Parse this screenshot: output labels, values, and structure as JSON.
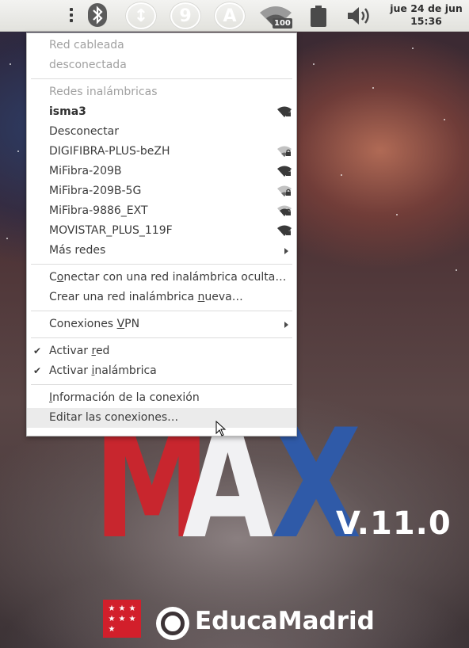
{
  "top_panel": {
    "circle_icons": [
      "↕",
      "9",
      "A"
    ],
    "wifi_badge": "100",
    "clock_date": "jue 24 de jun",
    "clock_time": "15:36"
  },
  "menu": {
    "wired_header": "Red cableada",
    "wired_status": "desconectada",
    "wireless_header": "Redes inalámbricas",
    "connected_network": "isma3",
    "disconnect": "Desconectar",
    "networks": [
      {
        "name": "DIGIFIBRA-PLUS-beZH",
        "signal": "low"
      },
      {
        "name": "MiFibra-209B",
        "signal": "high"
      },
      {
        "name": "MiFibra-209B-5G",
        "signal": "low"
      },
      {
        "name": "MiFibra-9886_EXT",
        "signal": "medium"
      },
      {
        "name": "MOVISTAR_PLUS_119F",
        "signal": "high"
      }
    ],
    "more_networks": "Más redes",
    "connect_hidden_pre": "C",
    "connect_hidden_u": "o",
    "connect_hidden_post": "nectar con una red inalámbrica oculta…",
    "create_new_pre": "Crear una red inalámbrica ",
    "create_new_u": "n",
    "create_new_post": "ueva…",
    "vpn_pre": "Conexiones ",
    "vpn_u": "V",
    "vpn_post": "PN",
    "enable_network_pre": "Activar ",
    "enable_network_u": "r",
    "enable_network_post": "ed",
    "enable_wireless_pre": "Activar ",
    "enable_wireless_u": "i",
    "enable_wireless_post": "nalámbrica",
    "connection_info_pre": "",
    "connection_info_u": "I",
    "connection_info_post": "nformación de la conexión",
    "edit_connections": "Editar las conexiones…"
  },
  "wallpaper": {
    "logo_letters": [
      "M",
      "A",
      "X"
    ],
    "version": "V.11.0",
    "brand": "EducaMadrid",
    "colors": {
      "m": "#c8262e",
      "a": "#f1f1f3",
      "x": "#2f5aa8",
      "flag": "#d21f2b"
    }
  }
}
